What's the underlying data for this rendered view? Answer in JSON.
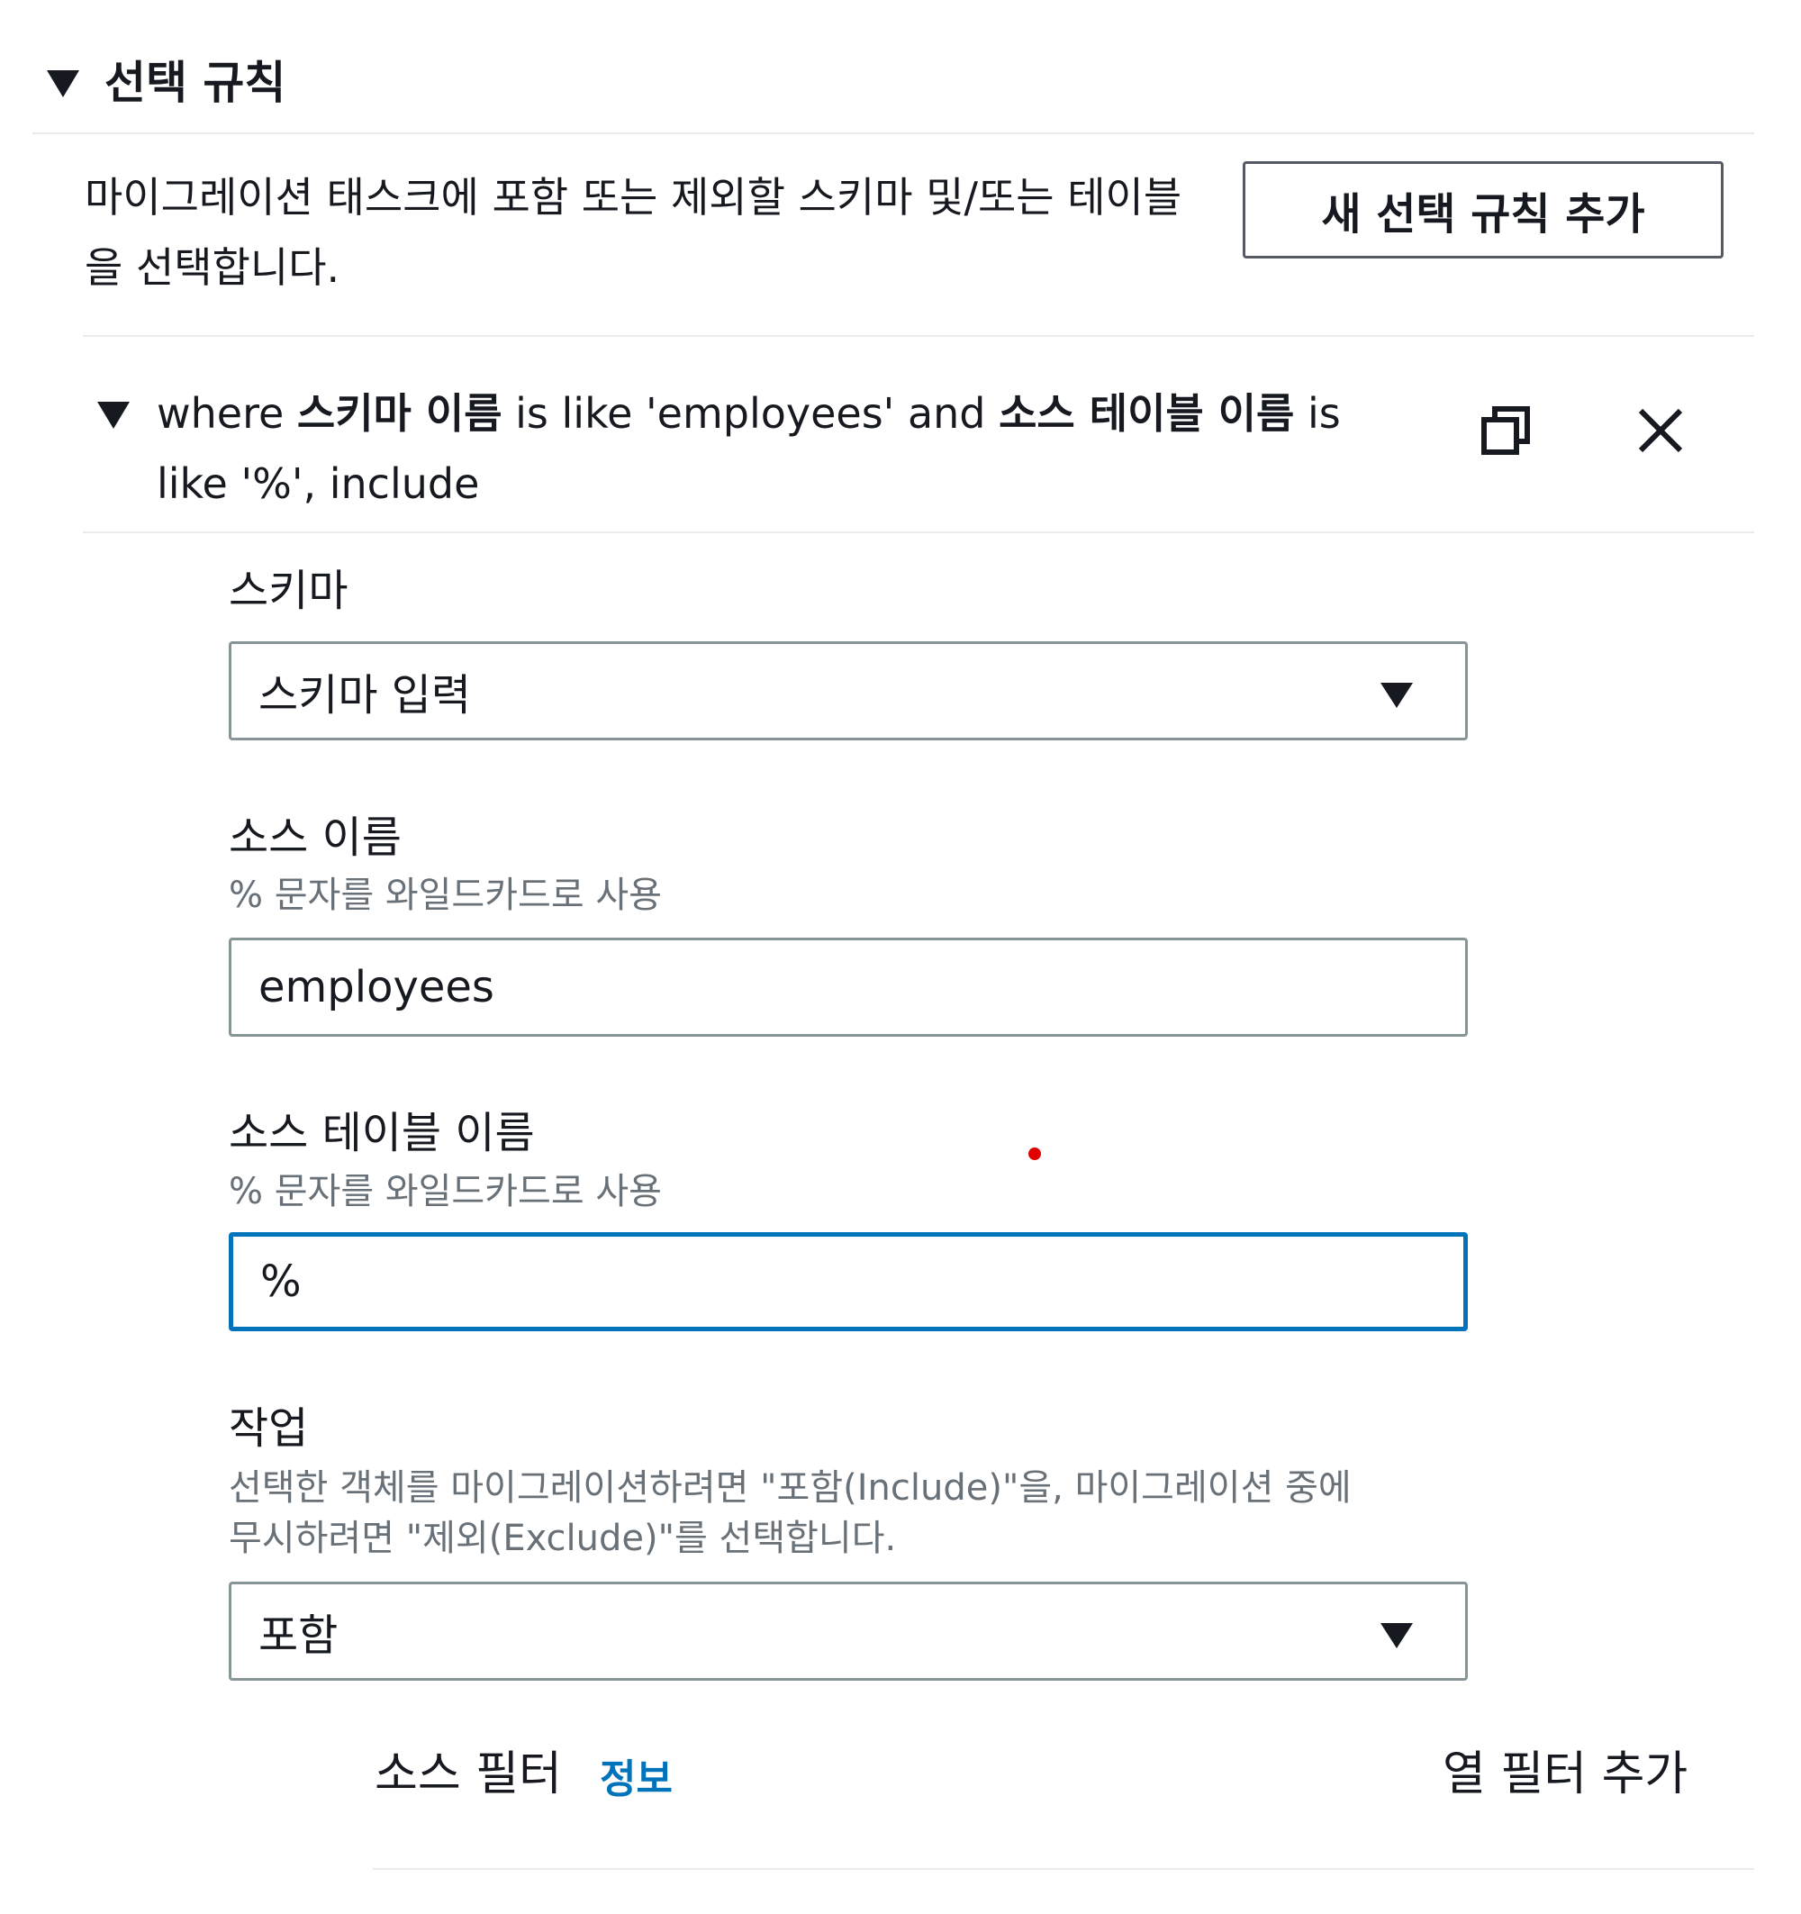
{
  "section": {
    "title": "선택 규칙",
    "description": "마이그레이션 태스크에 포함 또는 제외할 스키마 및/또는 테이블을 선택합니다.",
    "add_button_label": "새 선택 규칙 추가"
  },
  "rule": {
    "summary_parts": [
      "where ",
      "스키마 이름",
      " is like 'employees' and ",
      "소스 테이블 이름",
      " is like '%', include"
    ],
    "copy_icon": "copy-icon",
    "remove_icon": "close-icon"
  },
  "form": {
    "schema": {
      "label": "스키마",
      "value": "스키마 입력"
    },
    "source_name": {
      "label": "소스 이름",
      "hint": "% 문자를 와일드카드로 사용",
      "value": "employees"
    },
    "source_table": {
      "label": "소스 테이블 이름",
      "hint": "% 문자를 와일드카드로 사용",
      "value": "%"
    },
    "action": {
      "label": "작업",
      "hint_line1": "선택한 객체를 마이그레이션하려면 \"포함(Include)\"을, 마이그레이션 중에",
      "hint_line2": "무시하려면 \"제외(Exclude)\"를 선택합니다.",
      "value": "포함"
    }
  },
  "source_filter": {
    "label": "소스 필터",
    "info_link": "정보",
    "add_column_filter": "열 필터 추가"
  },
  "colors": {
    "focus_border": "#0073bb",
    "link": "#0073bb",
    "hint_text": "#687078",
    "cursor_marker": "#e00000"
  }
}
